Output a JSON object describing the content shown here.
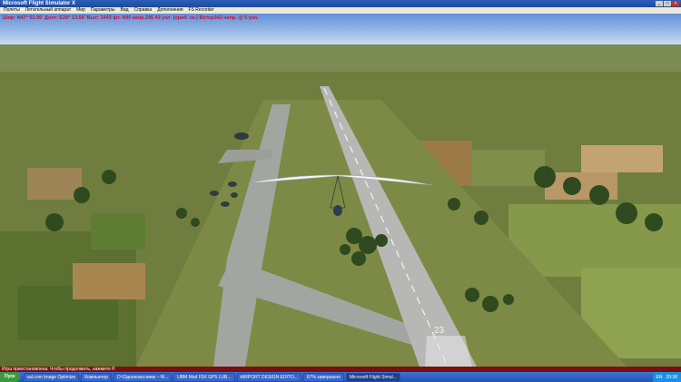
{
  "window": {
    "title": "Microsoft Flight Simulator X"
  },
  "menu": [
    "Полеты",
    "Летательный аппарат",
    "Мир",
    "Параметры",
    "Вид",
    "Справка",
    "Дополнения",
    "FS Recorder"
  ],
  "hud": {
    "text": "Шир: N47° 51.95'  Долг: E29° 13.56'  Выс: 1443 фт.  Н/И  напр.245  43 узл. (приб. ск.)  Ветер342 напр. @ 5 узл."
  },
  "pause_text": "Игра приостановлена. Чтобы продолжить, нажмите P.",
  "runway_number": "23",
  "taskbar": {
    "start": "Пуск",
    "items": [
      "val.com Image Optimize",
      "Компьютер",
      "D:\\Одноклассники – М...",
      "UBM Mod F5X GP5 LUB...",
      "AIRPORT DESIGN EDITO...",
      "67% завершено",
      "Microsoft Flight Simul..."
    ],
    "lang": "EN",
    "clock": "20:38"
  }
}
